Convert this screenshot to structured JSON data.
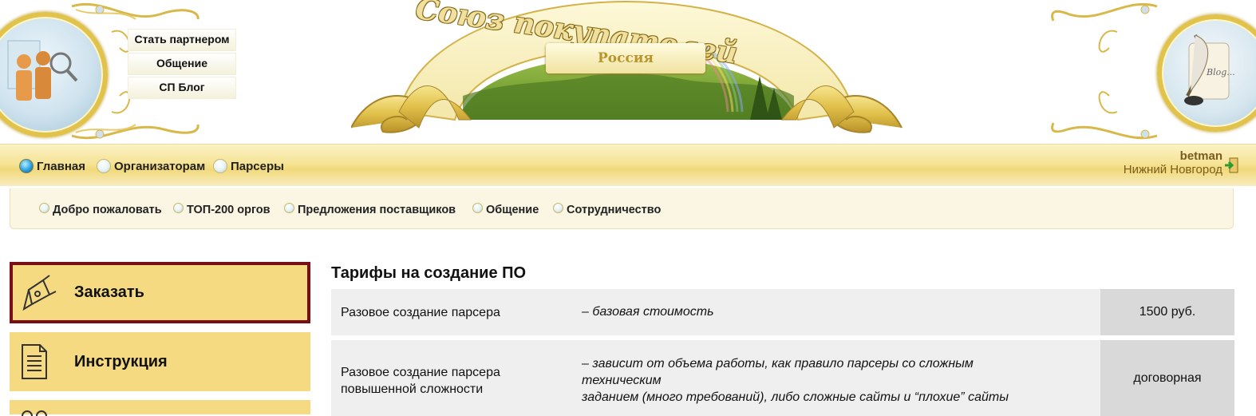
{
  "header": {
    "top_links": [
      "Стать партнером",
      "Общение",
      "СП Блог"
    ],
    "banner_title": "Союз покупателей",
    "banner_subtitle": "Россия",
    "blog_medallion_text": "Blog..."
  },
  "nav": {
    "items": [
      {
        "label": "Главная",
        "active": true
      },
      {
        "label": "Организаторам",
        "active": false
      },
      {
        "label": "Парсеры",
        "active": false
      }
    ],
    "user": {
      "name": "betman",
      "city": "Нижний Новгород"
    }
  },
  "subnav": {
    "items": [
      "Добро пожаловать",
      "ТОП-200 оргов",
      "Предложения поставщиков",
      "Общение",
      "Сотрудничество"
    ]
  },
  "sidebar": {
    "items": [
      {
        "label": "Заказать",
        "icon": "pen-nib-icon",
        "active": true
      },
      {
        "label": "Инструкция",
        "icon": "document-icon",
        "active": false
      }
    ]
  },
  "main": {
    "title": "Тарифы на создание ПО",
    "tariffs": [
      {
        "name": "Разовое создание парсера",
        "description": "– базовая стоимость",
        "price": "1500 руб."
      },
      {
        "name_lines": [
          "Разовое создание парсера",
          "повышенной сложности"
        ],
        "description_lines": [
          "– зависит от объема работы, как правило парсеры со сложным",
          "техническим",
          "заданием (много требований), либо сложные сайты и “плохие” сайты"
        ],
        "price": "договорная"
      }
    ]
  },
  "colors": {
    "gold_bar": "#f1d97a",
    "sidebar_button": "#f5da82",
    "active_border": "#7a0e16",
    "user_text": "#7a5c20"
  }
}
